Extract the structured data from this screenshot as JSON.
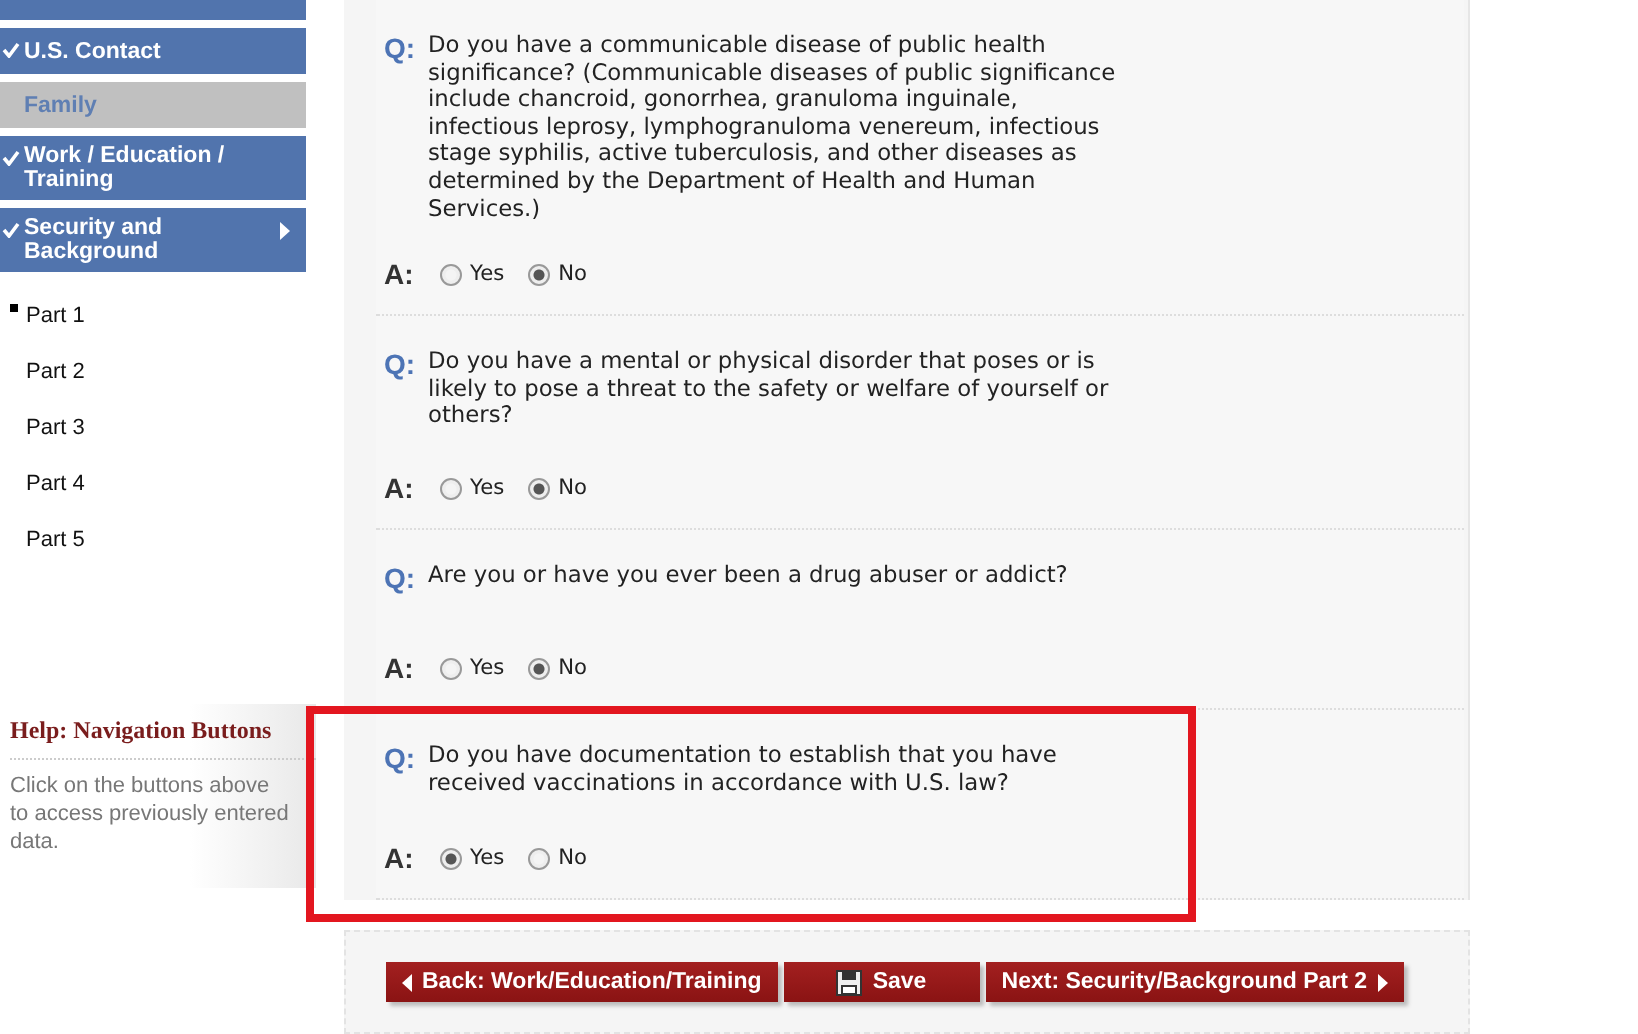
{
  "sidebar": {
    "items": [
      {
        "label": "U.S. Contact",
        "completed": true
      },
      {
        "label": "Family",
        "completed": false
      },
      {
        "label": "Work / Education / Training",
        "completed": true
      },
      {
        "label": "Security and Background",
        "completed": true,
        "expanded": true,
        "children": [
          {
            "label": "Part 1",
            "selected": true
          },
          {
            "label": "Part 2",
            "selected": false
          },
          {
            "label": "Part 3",
            "selected": false
          },
          {
            "label": "Part 4",
            "selected": false
          },
          {
            "label": "Part 5",
            "selected": false
          }
        ]
      }
    ]
  },
  "help": {
    "title": "Help: Navigation Buttons",
    "text": "Click on the buttons above to access previously entered data."
  },
  "questions": [
    {
      "q_label": "Q:",
      "question": "Do you have a communicable disease of public health significance? (Communicable diseases of public significance include chancroid, gonorrhea, granuloma inguinale, infectious leprosy, lymphogranuloma venereum, infectious stage syphilis, active tuberculosis, and other diseases as determined by the Department of Health and Human Services.)",
      "a_label": "A:",
      "options": [
        {
          "label": "Yes",
          "selected": false
        },
        {
          "label": "No",
          "selected": true
        }
      ],
      "highlighted": false
    },
    {
      "q_label": "Q:",
      "question": "Do you have a mental or physical disorder that poses or is likely to pose a threat to the safety or welfare of yourself or others?",
      "a_label": "A:",
      "options": [
        {
          "label": "Yes",
          "selected": false
        },
        {
          "label": "No",
          "selected": true
        }
      ],
      "highlighted": false
    },
    {
      "q_label": "Q:",
      "question": "Are you or have you ever been a drug abuser or addict?",
      "a_label": "A:",
      "options": [
        {
          "label": "Yes",
          "selected": false
        },
        {
          "label": "No",
          "selected": true
        }
      ],
      "highlighted": false
    },
    {
      "q_label": "Q:",
      "question": "Do you have documentation to establish that you have received vaccinations in accordance with U.S. law?",
      "a_label": "A:",
      "options": [
        {
          "label": "Yes",
          "selected": true
        },
        {
          "label": "No",
          "selected": false
        }
      ],
      "highlighted": true
    }
  ],
  "buttons": [
    {
      "kind": "back",
      "label": "Back: Work/Education/Training"
    },
    {
      "kind": "save",
      "label": "Save"
    },
    {
      "kind": "next",
      "label": "Next: Security/Background Part 2"
    }
  ]
}
